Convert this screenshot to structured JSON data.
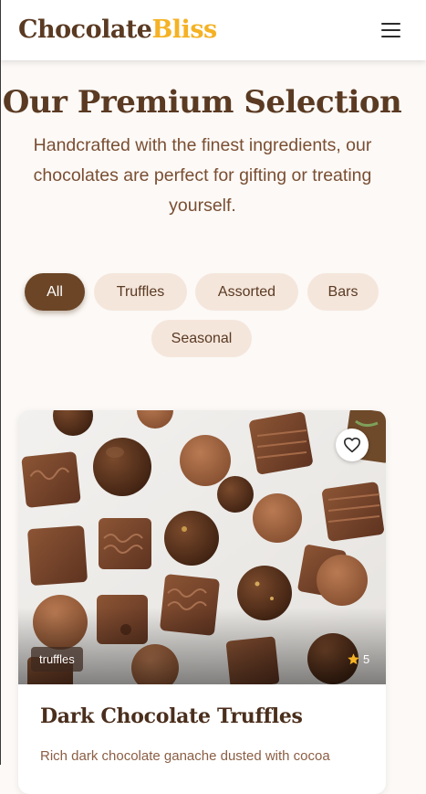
{
  "brand": {
    "name_part1": "Chocolate",
    "name_part2": "Bliss"
  },
  "header": {
    "menu_icon": "hamburger-menu-icon"
  },
  "hero": {
    "title": "Our Premium Selection",
    "subtitle": "Handcrafted with the finest ingredients, our chocolates are perfect for gifting or treating yourself."
  },
  "filters": {
    "items": [
      {
        "label": "All",
        "active": true
      },
      {
        "label": "Truffles",
        "active": false
      },
      {
        "label": "Assorted",
        "active": false
      },
      {
        "label": "Bars",
        "active": false
      },
      {
        "label": "Seasonal",
        "active": false
      }
    ]
  },
  "products": [
    {
      "name": "Dark Chocolate Truffles",
      "category": "truffles",
      "rating": "5",
      "description": "Rich dark chocolate ganache dusted with cocoa",
      "favorite_icon": "heart-outline-icon",
      "rating_icon": "star-icon"
    }
  ],
  "colors": {
    "brand_dark": "#5a3a22",
    "brand_accent": "#f4b224",
    "chip_bg": "#f5e6dc",
    "chip_active_bg": "#6b4526",
    "page_bg": "#fcf9f6",
    "star": "#f4b224"
  }
}
